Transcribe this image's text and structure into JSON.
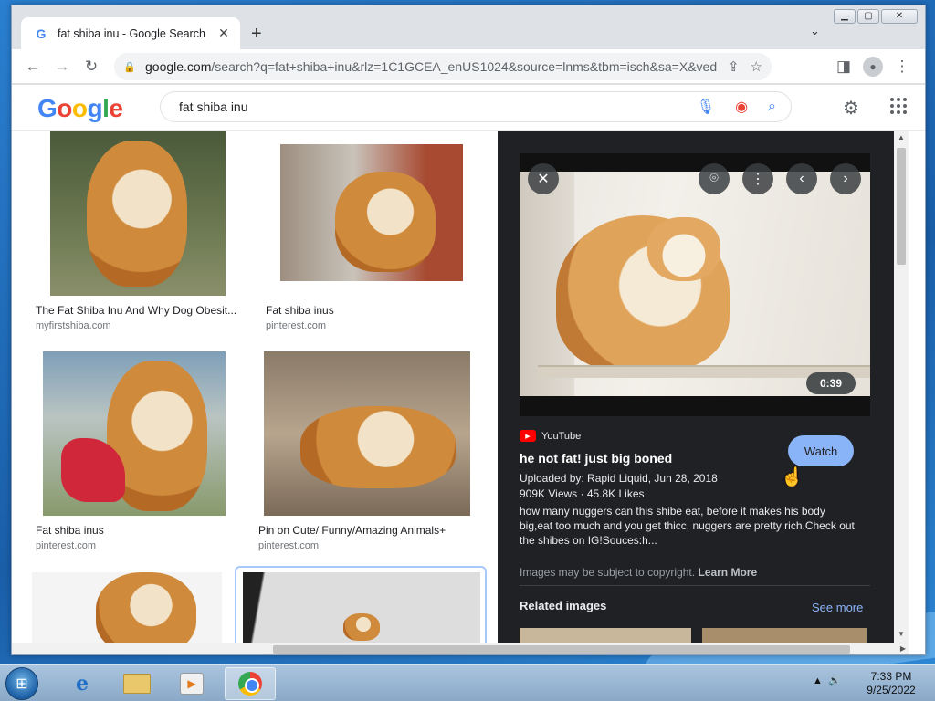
{
  "browser": {
    "tab": {
      "favicon": "google-g-icon",
      "title": "fat shiba inu - Google Search"
    },
    "url_host": "google.com",
    "url_path": "/search?q=fat+shiba+inu&rlz=1C1GCEA_enUS1024&source=lnms&tbm=isch&sa=X&ved=2ah..."
  },
  "google": {
    "logo": [
      "G",
      "o",
      "o",
      "g",
      "l",
      "e"
    ],
    "query": "fat shiba inu"
  },
  "results": [
    {
      "title": "The Fat Shiba Inu And Why Dog Obesit...",
      "source": "myfirstshiba.com"
    },
    {
      "title": "Fat shiba inus",
      "source": "pinterest.com"
    },
    {
      "title": "Fat shiba inus",
      "source": "pinterest.com"
    },
    {
      "title": "Pin on Cute/ Funny/Amazing Animals+",
      "source": "pinterest.com"
    }
  ],
  "preview": {
    "duration": "0:39",
    "platform": "YouTube",
    "title": "he not fat! just big boned",
    "uploaded": "Uploaded by: Rapid Liquid, Jun 28, 2018",
    "views": "909K Views · 45.8K Likes",
    "description": "how many nuggers can this shibe eat, before it makes his body big,eat too much and you get thicc, nuggers are pretty rich.Check out the shibes on IG!Souces:h...",
    "watch_label": "Watch",
    "copyright": "Images may be subject to copyright.",
    "learn_more": "Learn More",
    "related_heading": "Related images",
    "see_more": "See more"
  },
  "taskbar": {
    "time": "7:33 PM",
    "date": "9/25/2022"
  },
  "colors": {
    "accent": "#8ab4f8",
    "panel": "#202124",
    "youtube_red": "#ff0000"
  }
}
